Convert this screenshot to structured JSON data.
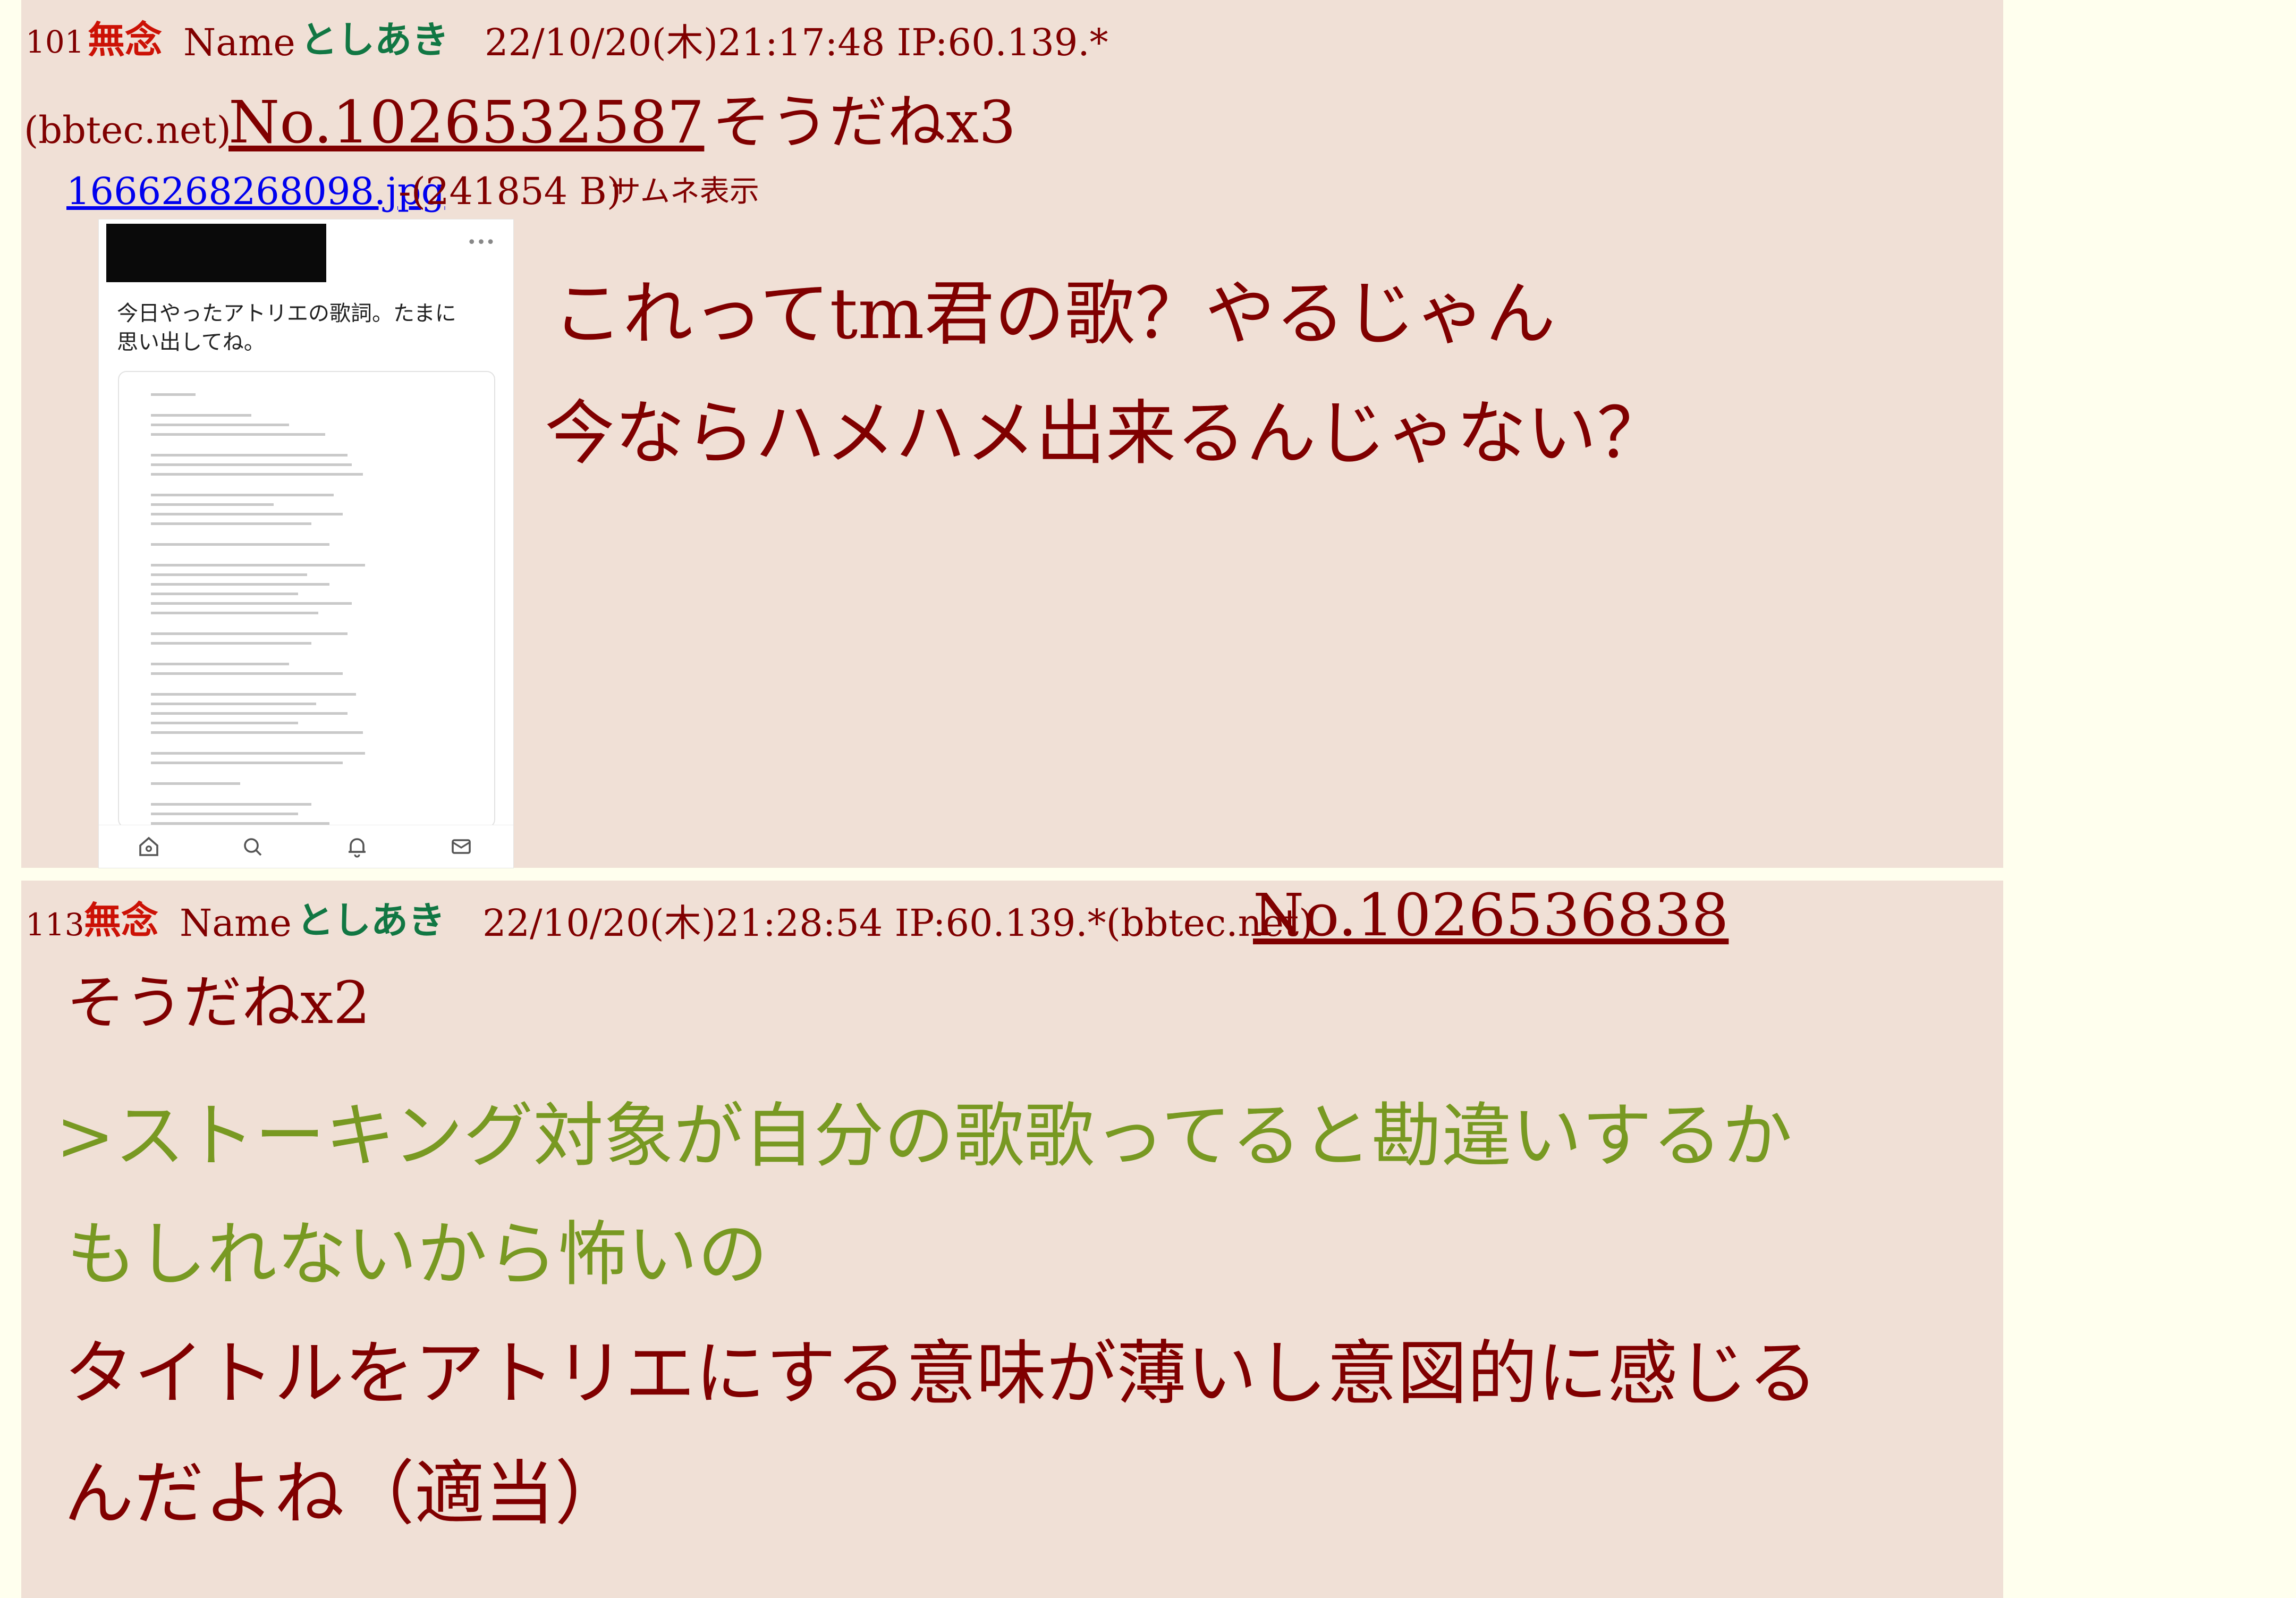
{
  "posts": [
    {
      "res_num": "101",
      "subject": "無念",
      "name_label": "Name",
      "username": "としあき",
      "datetime": "22/10/20(木)21:17:48 IP:60.139.*",
      "host": "(bbtec.net)",
      "post_no": "No.1026532587",
      "sodane": "そうだねx3",
      "file": {
        "filename": "1666268268098.jpg",
        "info": "-(241854 B)",
        "thumb_toggle": "サムネ表示"
      },
      "thumbnail": {
        "tweet_text": "今日やったアトリエの歌詞。たまに\n思い出してね。",
        "nav_icons": [
          "home-icon",
          "search-icon",
          "bell-icon",
          "mail-icon"
        ]
      },
      "body": [
        "これってtm君の歌？やるじゃん",
        "今ならハメハメ出来るんじゃない？"
      ]
    },
    {
      "res_num": "113",
      "subject": "無念",
      "name_label": "Name",
      "username": "としあき",
      "datetime": "22/10/20(木)21:28:54 IP:60.139.*(bbtec.net)",
      "post_no": "No.1026536838",
      "sodane": "そうだねx2",
      "quote": [
        ">ストーキング対象が自分の歌歌ってると勘違いするか",
        "もしれないから怖いの"
      ],
      "body": [
        "タイトルをアトリエにする意味が薄いし意図的に感じる",
        "んだよね（適当）"
      ]
    }
  ],
  "colors": {
    "page_background": "#ffffee",
    "post_background": "#f0e0d6",
    "text": "#800000",
    "subject": "#cc1105",
    "username": "#117743",
    "quote": "#789922",
    "file_link": "#0000ee"
  }
}
